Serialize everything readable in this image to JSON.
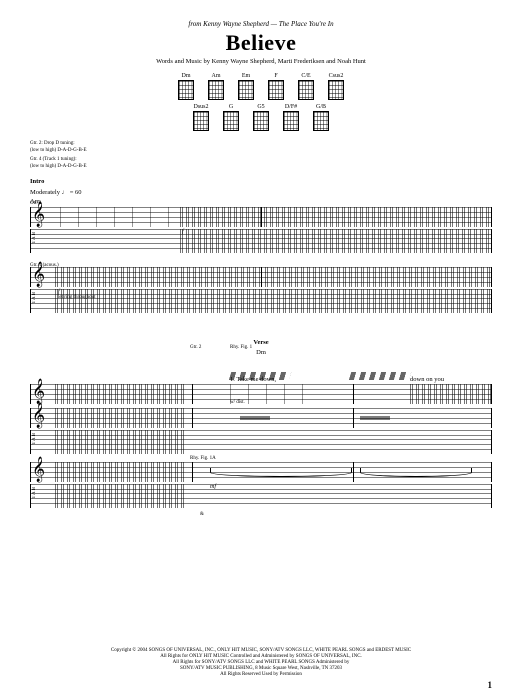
{
  "header": {
    "from_line": "from Kenny Wayne Shepherd — The Place You're In",
    "title": "Believe",
    "credits": "Words and Music by Kenny Wayne Shepherd, Marti Frederiksen and Noah Hunt"
  },
  "chord_diagrams": {
    "row1": [
      "Dm",
      "Am",
      "Em",
      "F",
      "C/E",
      "Csus2"
    ],
    "row2": [
      "Dsus2",
      "G",
      "G5",
      "D/F#",
      "G/B"
    ]
  },
  "tuning": {
    "line1": "Gtr. 2: Drop D tuning:",
    "line2": "(low to high) D-A-D-G-B-E",
    "line3": "Gtr. 4 (Track 1 tuning):",
    "line4": "(low to high) D-A-D-G-B-E"
  },
  "intro": {
    "label": "Intro",
    "tempo": "Moderately ♩ = 60",
    "chord": "Am",
    "dynamic_f": "f",
    "note": "let ring throughout",
    "gtr1": "Gtr. 1 (acous.)",
    "gtr2": "Gtr. 2"
  },
  "verse": {
    "label": "Verse",
    "chord": "Dm",
    "rhy_fig": "Rhy. Fig. 1",
    "rhy_fig_a": "Rhy. Fig. 1A",
    "gtr2": "Gtr. 2",
    "lyric1": "1. Take me down,",
    "lyric2": "down on you",
    "dynamic_mf": "mf",
    "bend_label": "w/ dist.",
    "ampersand": "&"
  },
  "copyright": {
    "line1": "Copyright © 2004 SONGS OF UNIVERSAL, INC., ONLY HIT MUSIC, SONY/ATV SONGS LLC, WHITE PEARL SONGS and ERDEST MUSIC",
    "line2": "All Rights for ONLY HIT MUSIC Controlled and Administered by SONGS OF UNIVERSAL, INC.",
    "line3": "All Rights for SONY/ATV SONGS LLC and WHITE PEARL SONGS Administered by",
    "line4": "SONY/ATV MUSIC PUBLISHING, 8 Music Square West, Nashville, TN 37203",
    "line5": "All Rights Reserved   Used by Permission"
  },
  "page_number": "1"
}
